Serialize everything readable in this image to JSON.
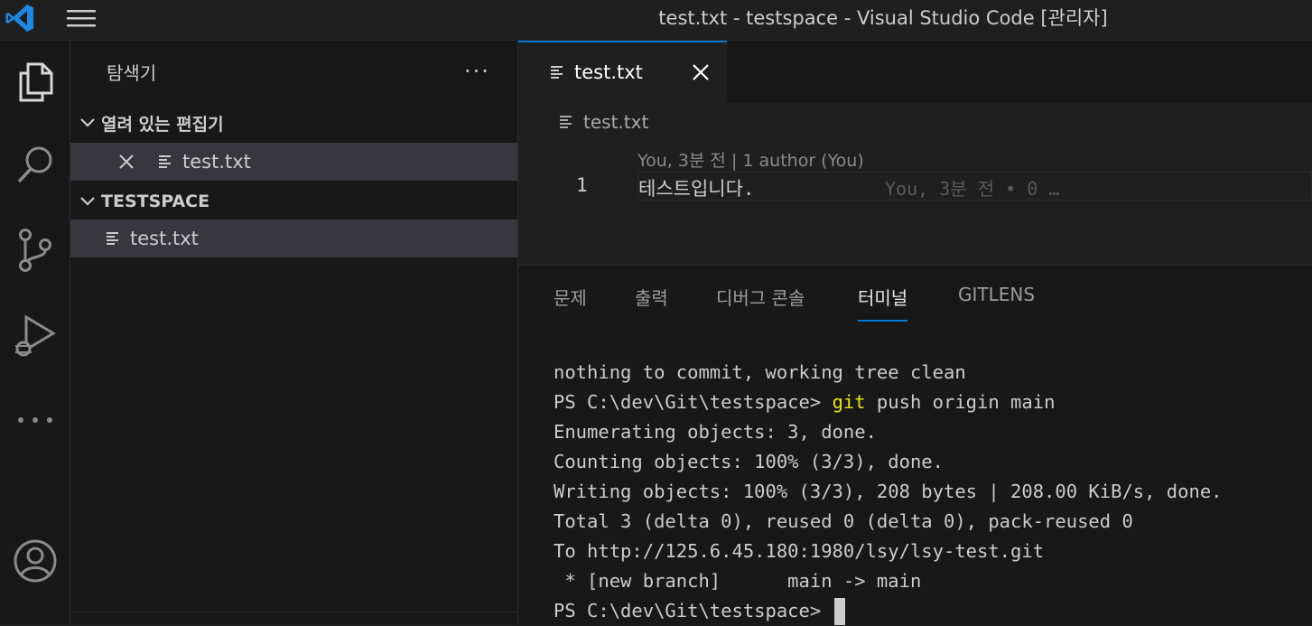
{
  "window": {
    "title": "test.txt - testspace - Visual Studio Code [관리자]"
  },
  "colors": {
    "accent": "#0078d4",
    "git_command": "#e5e510"
  },
  "activity_bar": {
    "items": [
      "explorer-icon",
      "search-icon",
      "source-control-icon",
      "run-debug-icon",
      "more-icon",
      "account-icon"
    ]
  },
  "sidebar": {
    "title": "탐색기",
    "more": "···",
    "open_editors": {
      "header": "열려 있는 편집기",
      "items": [
        {
          "label": "test.txt"
        }
      ]
    },
    "workspace": {
      "header": "TESTSPACE",
      "items": [
        {
          "label": "test.txt"
        }
      ]
    }
  },
  "editor": {
    "tab": {
      "label": "test.txt"
    },
    "breadcrumb": "test.txt",
    "codelens": "You, 3분 전 | 1 author (You)",
    "line_number": "1",
    "line_text": "테스트입니다.",
    "blame": "You, 3분 전 • 0 …"
  },
  "panel": {
    "tabs": [
      {
        "label": "문제",
        "active": false
      },
      {
        "label": "출력",
        "active": false
      },
      {
        "label": "디버그 콘솔",
        "active": false
      },
      {
        "label": "터미널",
        "active": true
      },
      {
        "label": "GITLENS",
        "active": false
      }
    ],
    "terminal": {
      "lines": [
        "nothing to commit, working tree clean",
        "Enumerating objects: 3, done.",
        "Counting objects: 100% (3/3), done.",
        "Writing objects: 100% (3/3), 208 bytes | 208.00 KiB/s, done.",
        "Total 3 (delta 0), reused 0 (delta 0), pack-reused 0",
        "To http://125.6.45.180:1980/lsy/lsy-test.git",
        " * [new branch]      main -> main"
      ],
      "prompt": "PS C:\\dev\\Git\\testspace> ",
      "push_cmd": "git",
      "push_args": " push origin main"
    }
  }
}
